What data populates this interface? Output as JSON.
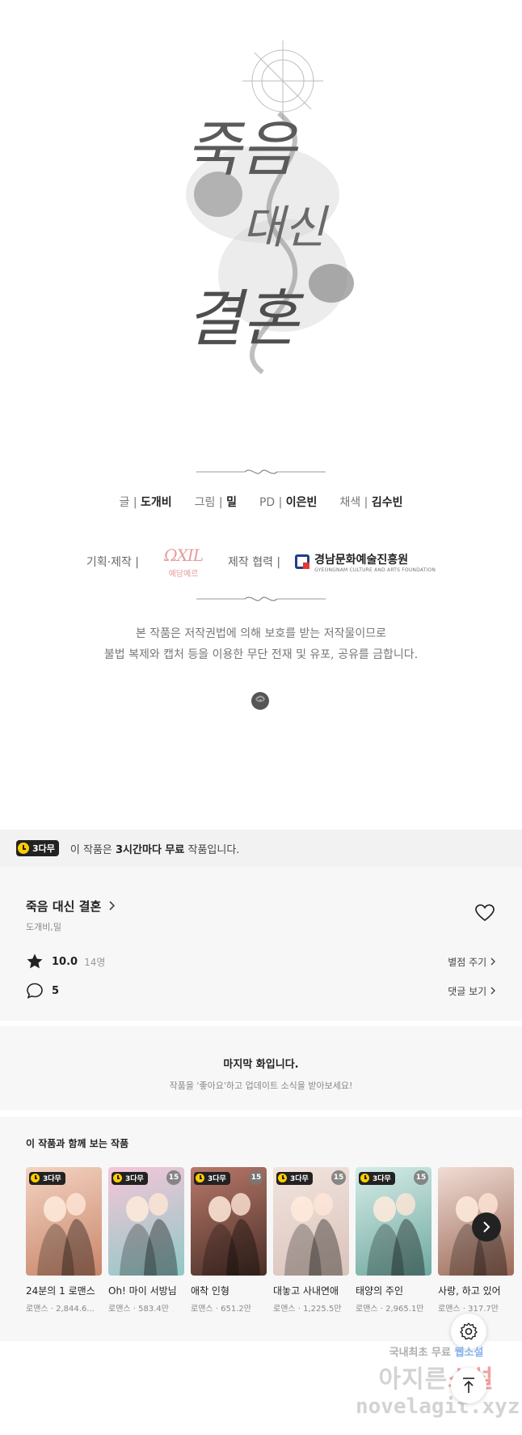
{
  "cover": {
    "title_lines": [
      "죽음",
      "대신",
      "결혼"
    ]
  },
  "credits": {
    "writer_role": "글 |",
    "writer": "도개비",
    "artist_role": "그림 |",
    "artist": "밀",
    "pd_role": "PD |",
    "pd": "이은빈",
    "color_role": "채색 |",
    "colorist": "김수빈",
    "production_role": "기획·제작 |",
    "production_logo": "예담예르",
    "production_logo_script": "ΩXIL",
    "coop_role": "제작 협력 |",
    "coop_name": "경남문화예술진흥원",
    "coop_sub": "GYEONGNAM CULTURE AND ARTS FOUNDATION"
  },
  "copyright": {
    "line1": "본 작품은 저작권법에 의해 보호를 받는 저작물이므로",
    "line2": "불법 복제와 캡처 등을 이용한 무단 전재 및 유포, 공유를 금합니다."
  },
  "free_banner": {
    "badge": "3다무",
    "text_pre": "이 작품은 ",
    "text_bold": "3시간마다 무료",
    "text_post": " 작품입니다."
  },
  "info": {
    "title": "죽음 대신 결혼",
    "author": "도개비,밀",
    "rating": "10.0",
    "rating_count": "14명",
    "rate_link": "별점 주기",
    "comments": "5",
    "comments_link": "댓글 보기"
  },
  "notice": {
    "title": "마지막 화입니다.",
    "subtitle": "작품을 '좋아요'하고 업데이트 소식을 받아보세요!"
  },
  "recommend": {
    "title": "이 작품과 함께 보는 작품",
    "items": [
      {
        "title": "24분의 1 로맨스",
        "meta": "로맨스 · 2,844.6...",
        "badge": "3다무",
        "age": "",
        "color1": "#c9866a",
        "color2": "#f3d3c2"
      },
      {
        "title": "Oh! 마이 서방님",
        "meta": "로맨스 · 583.4만",
        "badge": "3다무",
        "age": "15",
        "color1": "#8fc8c6",
        "color2": "#f6c6d8"
      },
      {
        "title": "애착 인형",
        "meta": "로맨스 · 651.2만",
        "badge": "3다무",
        "age": "15",
        "color1": "#4a3028",
        "color2": "#b9786a"
      },
      {
        "title": "대놓고 사내연애",
        "meta": "로맨스 · 1,225.5만",
        "badge": "3다무",
        "age": "15",
        "color1": "#d9c3bb",
        "color2": "#f2e4de"
      },
      {
        "title": "태양의 주인",
        "meta": "로맨스 · 2,965.1만",
        "badge": "3다무",
        "age": "15",
        "color1": "#6fa9a0",
        "color2": "#d6ece7"
      },
      {
        "title": "사랑, 하고 있어",
        "meta": "로맨스 · 317.7만",
        "badge": "",
        "age": "",
        "color1": "#9c6a58",
        "color2": "#f0dcd4"
      }
    ]
  },
  "watermark": {
    "line1_a": "국내최초 무료 ",
    "line1_b": "웹소설",
    "line2_a": "아지른",
    "line2_b": "소설",
    "line3": "novelagit.xyz"
  }
}
